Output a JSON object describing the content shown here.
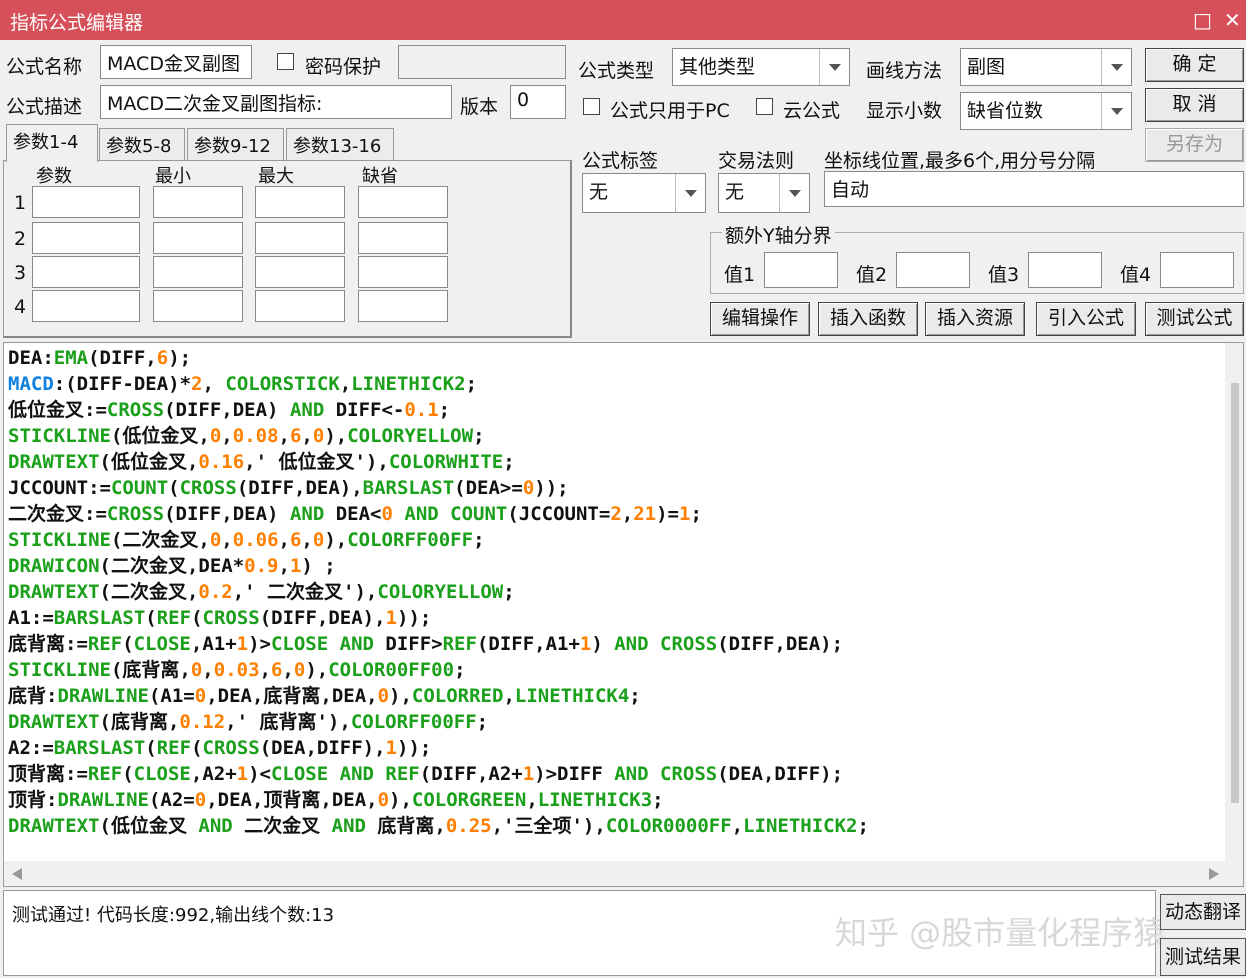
{
  "window": {
    "title": "指标公式编辑器",
    "max_icon": "□",
    "close_icon": "✕"
  },
  "form": {
    "name_label": "公式名称",
    "name_value": "MACD金叉副图",
    "password_label": "密码保护",
    "desc_label": "公式描述",
    "desc_value": "MACD二次金叉副图指标:",
    "version_label": "版本",
    "version_value": "0",
    "type_label": "公式类型",
    "type_value": "其他类型",
    "draw_label": "画线方法",
    "draw_value": "副图",
    "pc_only_label": "公式只用于PC",
    "cloud_label": "云公式",
    "decimals_label": "显示小数",
    "decimals_value": "缺省位数",
    "tag_label": "公式标签",
    "tag_value": "无",
    "trade_label": "交易法则",
    "trade_value": "无",
    "coord_label": "坐标线位置,最多6个,用分号分隔",
    "coord_value": "自动",
    "yaxis_group": "额外Y轴分界",
    "val1": "值1",
    "val2": "值2",
    "val3": "值3",
    "val4": "值4"
  },
  "buttons": {
    "ok": "确  定",
    "cancel": "取  消",
    "save_as": "另存为",
    "edit_ops": "编辑操作",
    "insert_func": "插入函数",
    "insert_res": "插入资源",
    "import_formula": "引入公式",
    "test_formula": "测试公式",
    "dyn_translate": "动态翻译",
    "test_result": "测试结果"
  },
  "params": {
    "tabs": [
      "参数1-4",
      "参数5-8",
      "参数9-12",
      "参数13-16"
    ],
    "headers": [
      "参数",
      "最小",
      "最大",
      "缺省"
    ],
    "rows": [
      "1",
      "2",
      "3",
      "4"
    ]
  },
  "colors": {
    "kw": "#1aa01a",
    "num": "#ff8000",
    "macd": "#1080e0",
    "plain": "#111111",
    "title": "#d6505a"
  },
  "code": [
    [
      [
        "DEA:",
        "p"
      ],
      [
        "EMA",
        "k"
      ],
      [
        "(DIFF,",
        "p"
      ],
      [
        "6",
        "n"
      ],
      [
        ");",
        "p"
      ]
    ],
    [
      [
        "MACD",
        "m"
      ],
      [
        ":(DIFF-DEA)*",
        "p"
      ],
      [
        "2",
        "n"
      ],
      [
        ", ",
        "p"
      ],
      [
        "COLORSTICK",
        "k"
      ],
      [
        ",",
        "p"
      ],
      [
        "LINETHICK2",
        "k"
      ],
      [
        ";",
        "p"
      ]
    ],
    [
      [
        "低位金叉:=",
        "p"
      ],
      [
        "CROSS",
        "k"
      ],
      [
        "(DIFF,DEA) ",
        "p"
      ],
      [
        "AND",
        "k"
      ],
      [
        " DIFF<-",
        "p"
      ],
      [
        "0.1",
        "n"
      ],
      [
        ";",
        "p"
      ]
    ],
    [
      [
        "STICKLINE",
        "k"
      ],
      [
        "(低位金叉,",
        "p"
      ],
      [
        "0",
        "n"
      ],
      [
        ",",
        "p"
      ],
      [
        "0.08",
        "n"
      ],
      [
        ",",
        "p"
      ],
      [
        "6",
        "n"
      ],
      [
        ",",
        "p"
      ],
      [
        "0",
        "n"
      ],
      [
        "),",
        "p"
      ],
      [
        "COLORYELLOW",
        "k"
      ],
      [
        ";",
        "p"
      ]
    ],
    [
      [
        "DRAWTEXT",
        "k"
      ],
      [
        "(低位金叉,",
        "p"
      ],
      [
        "0.16",
        "n"
      ],
      [
        ",' 低位金叉'),",
        "p"
      ],
      [
        "COLORWHITE",
        "k"
      ],
      [
        ";",
        "p"
      ]
    ],
    [
      [
        "JCCOUNT:=",
        "p"
      ],
      [
        "COUNT",
        "k"
      ],
      [
        "(",
        "p"
      ],
      [
        "CROSS",
        "k"
      ],
      [
        "(DIFF,DEA),",
        "p"
      ],
      [
        "BARSLAST",
        "k"
      ],
      [
        "(DEA>=",
        "p"
      ],
      [
        "0",
        "n"
      ],
      [
        "));",
        "p"
      ]
    ],
    [
      [
        "二次金叉:=",
        "p"
      ],
      [
        "CROSS",
        "k"
      ],
      [
        "(DIFF,DEA) ",
        "p"
      ],
      [
        "AND",
        "k"
      ],
      [
        " DEA<",
        "p"
      ],
      [
        "0",
        "n"
      ],
      [
        " ",
        "p"
      ],
      [
        "AND",
        "k"
      ],
      [
        " ",
        "p"
      ],
      [
        "COUNT",
        "k"
      ],
      [
        "(JCCOUNT=",
        "p"
      ],
      [
        "2",
        "n"
      ],
      [
        ",",
        "p"
      ],
      [
        "21",
        "n"
      ],
      [
        ")=",
        "p"
      ],
      [
        "1",
        "n"
      ],
      [
        ";",
        "p"
      ]
    ],
    [
      [
        "STICKLINE",
        "k"
      ],
      [
        "(二次金叉,",
        "p"
      ],
      [
        "0",
        "n"
      ],
      [
        ",",
        "p"
      ],
      [
        "0.06",
        "n"
      ],
      [
        ",",
        "p"
      ],
      [
        "6",
        "n"
      ],
      [
        ",",
        "p"
      ],
      [
        "0",
        "n"
      ],
      [
        "),",
        "p"
      ],
      [
        "COLORFF00FF",
        "k"
      ],
      [
        ";",
        "p"
      ]
    ],
    [
      [
        "DRAWICON",
        "k"
      ],
      [
        "(二次金叉,DEA*",
        "p"
      ],
      [
        "0.9",
        "n"
      ],
      [
        ",",
        "p"
      ],
      [
        "1",
        "n"
      ],
      [
        ") ;",
        "p"
      ]
    ],
    [
      [
        "DRAWTEXT",
        "k"
      ],
      [
        "(二次金叉,",
        "p"
      ],
      [
        "0.2",
        "n"
      ],
      [
        ",' 二次金叉'),",
        "p"
      ],
      [
        "COLORYELLOW",
        "k"
      ],
      [
        ";",
        "p"
      ]
    ],
    [
      [
        "A1:=",
        "p"
      ],
      [
        "BARSLAST",
        "k"
      ],
      [
        "(",
        "p"
      ],
      [
        "REF",
        "k"
      ],
      [
        "(",
        "p"
      ],
      [
        "CROSS",
        "k"
      ],
      [
        "(DIFF,DEA),",
        "p"
      ],
      [
        "1",
        "n"
      ],
      [
        "));",
        "p"
      ]
    ],
    [
      [
        "底背离:=",
        "p"
      ],
      [
        "REF",
        "k"
      ],
      [
        "(",
        "p"
      ],
      [
        "CLOSE",
        "k"
      ],
      [
        ",A1+",
        "p"
      ],
      [
        "1",
        "n"
      ],
      [
        ")>",
        "p"
      ],
      [
        "CLOSE",
        "k"
      ],
      [
        " ",
        "p"
      ],
      [
        "AND",
        "k"
      ],
      [
        " DIFF>",
        "p"
      ],
      [
        "REF",
        "k"
      ],
      [
        "(DIFF,A1+",
        "p"
      ],
      [
        "1",
        "n"
      ],
      [
        ") ",
        "p"
      ],
      [
        "AND",
        "k"
      ],
      [
        " ",
        "p"
      ],
      [
        "CROSS",
        "k"
      ],
      [
        "(DIFF,DEA);",
        "p"
      ]
    ],
    [
      [
        "STICKLINE",
        "k"
      ],
      [
        "(底背离,",
        "p"
      ],
      [
        "0",
        "n"
      ],
      [
        ",",
        "p"
      ],
      [
        "0.03",
        "n"
      ],
      [
        ",",
        "p"
      ],
      [
        "6",
        "n"
      ],
      [
        ",",
        "p"
      ],
      [
        "0",
        "n"
      ],
      [
        "),",
        "p"
      ],
      [
        "COLOR00FF00",
        "k"
      ],
      [
        ";",
        "p"
      ]
    ],
    [
      [
        "底背:",
        "p"
      ],
      [
        "DRAWLINE",
        "k"
      ],
      [
        "(A1=",
        "p"
      ],
      [
        "0",
        "n"
      ],
      [
        ",DEA,底背离,DEA,",
        "p"
      ],
      [
        "0",
        "n"
      ],
      [
        "),",
        "p"
      ],
      [
        "COLORRED",
        "k"
      ],
      [
        ",",
        "p"
      ],
      [
        "LINETHICK4",
        "k"
      ],
      [
        ";",
        "p"
      ]
    ],
    [
      [
        "DRAWTEXT",
        "k"
      ],
      [
        "(底背离,",
        "p"
      ],
      [
        "0.12",
        "n"
      ],
      [
        ",' 底背离'),",
        "p"
      ],
      [
        "COLORFF00FF",
        "k"
      ],
      [
        ";",
        "p"
      ]
    ],
    [
      [
        "A2:=",
        "p"
      ],
      [
        "BARSLAST",
        "k"
      ],
      [
        "(",
        "p"
      ],
      [
        "REF",
        "k"
      ],
      [
        "(",
        "p"
      ],
      [
        "CROSS",
        "k"
      ],
      [
        "(DEA,DIFF),",
        "p"
      ],
      [
        "1",
        "n"
      ],
      [
        "));",
        "p"
      ]
    ],
    [
      [
        "顶背离:=",
        "p"
      ],
      [
        "REF",
        "k"
      ],
      [
        "(",
        "p"
      ],
      [
        "CLOSE",
        "k"
      ],
      [
        ",A2+",
        "p"
      ],
      [
        "1",
        "n"
      ],
      [
        ")<",
        "p"
      ],
      [
        "CLOSE",
        "k"
      ],
      [
        " ",
        "p"
      ],
      [
        "AND",
        "k"
      ],
      [
        " ",
        "p"
      ],
      [
        "REF",
        "k"
      ],
      [
        "(DIFF,A2+",
        "p"
      ],
      [
        "1",
        "n"
      ],
      [
        ")>DIFF ",
        "p"
      ],
      [
        "AND",
        "k"
      ],
      [
        " ",
        "p"
      ],
      [
        "CROSS",
        "k"
      ],
      [
        "(DEA,DIFF);",
        "p"
      ]
    ],
    [
      [
        "顶背:",
        "p"
      ],
      [
        "DRAWLINE",
        "k"
      ],
      [
        "(A2=",
        "p"
      ],
      [
        "0",
        "n"
      ],
      [
        ",DEA,顶背离,DEA,",
        "p"
      ],
      [
        "0",
        "n"
      ],
      [
        "),",
        "p"
      ],
      [
        "COLORGREEN",
        "k"
      ],
      [
        ",",
        "p"
      ],
      [
        "LINETHICK3",
        "k"
      ],
      [
        ";",
        "p"
      ]
    ],
    [
      [
        "DRAWTEXT",
        "k"
      ],
      [
        "(低位金叉 ",
        "p"
      ],
      [
        "AND",
        "k"
      ],
      [
        " 二次金叉 ",
        "p"
      ],
      [
        "AND",
        "k"
      ],
      [
        " 底背离,",
        "p"
      ],
      [
        "0.25",
        "n"
      ],
      [
        ",'三全项'),",
        "p"
      ],
      [
        "COLOR0000FF",
        "k"
      ],
      [
        ",",
        "p"
      ],
      [
        "LINETHICK2",
        "k"
      ],
      [
        ";",
        "p"
      ]
    ]
  ],
  "status": {
    "message": "测试通过! 代码长度:992,输出线个数:13",
    "watermark": "知乎 @股市量化程序猿"
  }
}
